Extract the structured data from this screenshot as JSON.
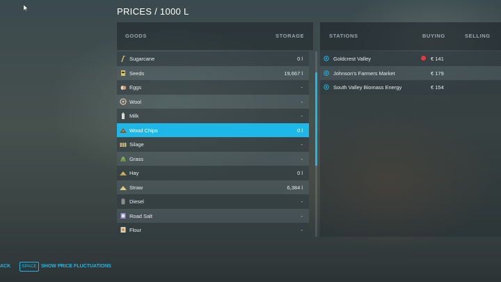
{
  "header": {
    "title": "PRICES / 1000 L"
  },
  "goods_panel": {
    "col_goods": "GOODS",
    "col_storage": "STORAGE",
    "items": [
      {
        "name": "Sugarcane",
        "storage": "0 l",
        "icon": "sugarcane-icon"
      },
      {
        "name": "Seeds",
        "storage": "19,667 l",
        "icon": "seeds-icon"
      },
      {
        "name": "Eggs",
        "storage": "-",
        "icon": "eggs-icon"
      },
      {
        "name": "Wool",
        "storage": "-",
        "icon": "wool-icon"
      },
      {
        "name": "Milk",
        "storage": "-",
        "icon": "milk-icon"
      },
      {
        "name": "Wood Chips",
        "storage": "0 l",
        "icon": "wood-chips-icon",
        "selected": true
      },
      {
        "name": "Silage",
        "storage": "-",
        "icon": "silage-icon"
      },
      {
        "name": "Grass",
        "storage": "-",
        "icon": "grass-icon"
      },
      {
        "name": "Hay",
        "storage": "0 l",
        "icon": "hay-icon"
      },
      {
        "name": "Straw",
        "storage": "6,384 l",
        "icon": "straw-icon"
      },
      {
        "name": "Diesel",
        "storage": "-",
        "icon": "diesel-icon"
      },
      {
        "name": "Road Salt",
        "storage": "-",
        "icon": "road-salt-icon"
      },
      {
        "name": "Flour",
        "storage": "-",
        "icon": "flour-icon"
      }
    ]
  },
  "stations_panel": {
    "col_stations": "STATIONS",
    "col_buying": "BUYING",
    "col_selling": "SELLING",
    "items": [
      {
        "name": "Goldcrest Valley",
        "buying": "€ 141",
        "alert": true
      },
      {
        "name": "Johnson's Farmers Market",
        "buying": "€ 179",
        "alert": false
      },
      {
        "name": "South Valley Biomass Energy",
        "buying": "€ 154",
        "alert": false
      }
    ]
  },
  "footer": {
    "back_label": "ACK",
    "key_label": "SPACE",
    "fluctuations_label": "SHOW PRICE FLUCTUATIONS"
  },
  "colors": {
    "accent": "#1eb8e8",
    "alert": "#e23a3a"
  }
}
